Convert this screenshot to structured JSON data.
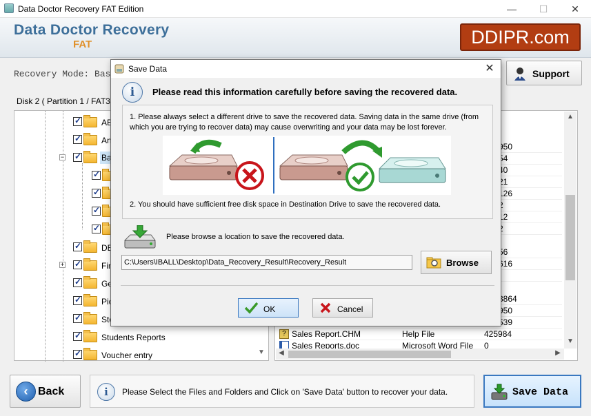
{
  "window": {
    "title": "Data Doctor Recovery FAT Edition",
    "minimize": "—",
    "maximize": "☐",
    "close": "✕"
  },
  "header": {
    "brand_line1": "Data Doctor Recovery",
    "brand_line2": "FAT",
    "badge": "DDIPR.com"
  },
  "mode": {
    "label": "Recovery Mode: Bas",
    "support_label": "Support"
  },
  "disk": {
    "label": "Disk 2 ( Partition 1 / FAT32 /"
  },
  "tree": {
    "items": [
      {
        "label": "AB"
      },
      {
        "label": "An"
      },
      {
        "label": "Ba"
      },
      {
        "label": ""
      },
      {
        "label": ""
      },
      {
        "label": ""
      },
      {
        "label": ""
      },
      {
        "label": "DE"
      },
      {
        "label": "Fin"
      },
      {
        "label": "Ge"
      },
      {
        "label": "Pic"
      },
      {
        "label": "Sto"
      },
      {
        "label": "Students Reports"
      },
      {
        "label": "Voucher entry"
      }
    ]
  },
  "list": {
    "rows": [
      {
        "name": "",
        "type": "",
        "size": "950"
      },
      {
        "name": "",
        "type": "",
        "size": "54"
      },
      {
        "name": "",
        "type": "",
        "size": "40"
      },
      {
        "name": "",
        "type": "",
        "size": "21"
      },
      {
        "name": "",
        "type": "",
        "size": "126"
      },
      {
        "name": "",
        "type": "",
        "size": "2"
      },
      {
        "name": "",
        "type": "",
        "size": "12"
      },
      {
        "name": "",
        "type": "",
        "size": "2"
      },
      {
        "name": "",
        "type": "",
        "size": "56"
      },
      {
        "name": "",
        "type": "",
        "size": "616"
      },
      {
        "name": "",
        "type": "",
        "size": ""
      },
      {
        "name": "",
        "type": "",
        "size": "3864"
      },
      {
        "name": "",
        "type": "",
        "size": "950"
      },
      {
        "name": "",
        "type": "",
        "size": "539"
      },
      {
        "name": "Sales Report.CHM",
        "type": "Help File",
        "size": "425984"
      },
      {
        "name": "Sales Reports.doc",
        "type": "Microsoft Word File",
        "size": "0"
      }
    ]
  },
  "footer": {
    "back_label": "Back",
    "info_text": "Please Select the Files and Folders and Click on 'Save Data' button to recover your data.",
    "save_label": "Save Data"
  },
  "dialog": {
    "title": "Save Data",
    "heading": "Please read this information carefully before saving the recovered data.",
    "note1": "1. Please always select a different drive to save the recovered data. Saving data in the same drive (from which you are trying to recover data) may cause overwriting and your data may be lost forever.",
    "note2": "2. You should have sufficient free disk space in Destination Drive to save the recovered data.",
    "browse_prompt": "Please browse a location to save the recovered data.",
    "path_value": "C:\\Users\\IBALL\\Desktop\\Data_Recovery_Result\\Recovery_Result",
    "browse_label": "Browse",
    "ok_label": "OK",
    "cancel_label": "Cancel"
  }
}
